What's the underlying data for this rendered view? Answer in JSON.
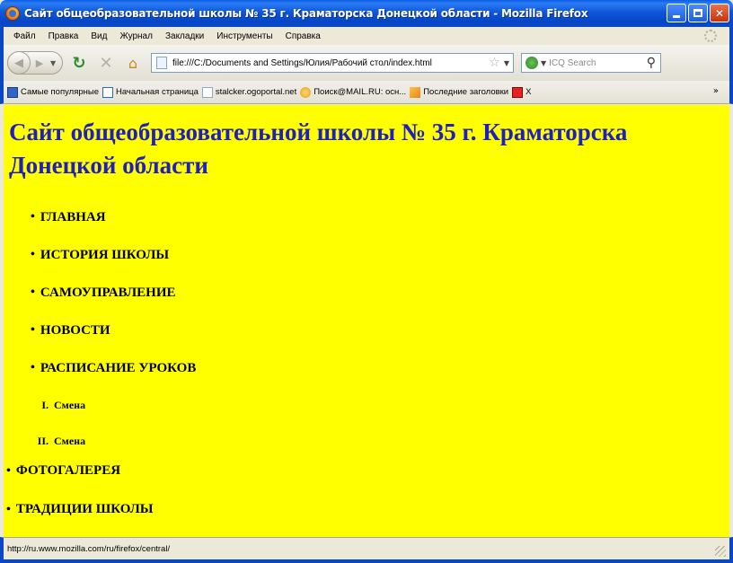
{
  "window": {
    "title": "Сайт общеобразовательной школы № 35 г. Краматорска Донецкой области - Mozilla Firefox"
  },
  "menu": [
    "Файл",
    "Правка",
    "Вид",
    "Журнал",
    "Закладки",
    "Инструменты",
    "Справка"
  ],
  "toolbar": {
    "url": "file:///C:/Documents and Settings/Юлия/Рабочий стол/index.html",
    "search_placeholder": "ICQ Search"
  },
  "bookmarks": [
    {
      "label": "Самые популярные",
      "icon": "blue"
    },
    {
      "label": "Начальная страница",
      "icon": "tab"
    },
    {
      "label": "stalcker.ogoportal.net",
      "icon": "page"
    },
    {
      "label": "Поиск@MAIL.RU: осн...",
      "icon": "search"
    },
    {
      "label": "Последние заголовки",
      "icon": "rss"
    },
    {
      "label": "X",
      "icon": "red"
    }
  ],
  "page": {
    "heading": "Сайт общеобразовательной школы № 35 г. Краматорска Донецкой области",
    "nav": [
      "ГЛАВНАЯ",
      "ИСТОРИЯ ШКОЛЫ",
      "САМОУПРАВЛЕНИЕ",
      "НОВОСТИ",
      "РАСПИСАНИЕ УРОКОВ"
    ],
    "shifts": [
      {
        "num": "I.",
        "label": "Смена"
      },
      {
        "num": "II.",
        "label": "Смена"
      }
    ],
    "more": [
      "ФОТОГАЛЕРЕЯ",
      "ТРАДИЦИИ ШКОЛЫ"
    ]
  },
  "status": {
    "text": "http://ru.www.mozilla.com/ru/firefox/central/"
  }
}
